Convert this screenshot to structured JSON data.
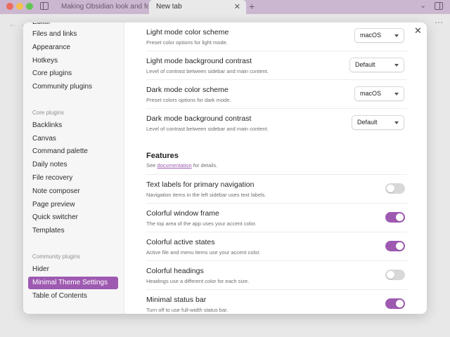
{
  "colors": {
    "accent": "#9e5ab1",
    "titlebar": "#cbb7cf"
  },
  "titlebar": {
    "tabs": [
      {
        "label": "Making Obsidian look and fe..."
      },
      {
        "label": "New tab"
      }
    ],
    "close_glyph": "✕",
    "new_tab_glyph": "+",
    "chevron_glyph": "⌄"
  },
  "background": {
    "nav_glyph": "←  →",
    "more_glyph": "⋯"
  },
  "modal": {
    "close_glyph": "✕",
    "sidebar": {
      "options_items": [
        {
          "label": "Editor"
        },
        {
          "label": "Files and links"
        },
        {
          "label": "Appearance"
        },
        {
          "label": "Hotkeys"
        },
        {
          "label": "Core plugins"
        },
        {
          "label": "Community plugins"
        }
      ],
      "core_heading": "Core plugins",
      "core_items": [
        {
          "label": "Backlinks"
        },
        {
          "label": "Canvas"
        },
        {
          "label": "Command palette"
        },
        {
          "label": "Daily notes"
        },
        {
          "label": "File recovery"
        },
        {
          "label": "Note composer"
        },
        {
          "label": "Page preview"
        },
        {
          "label": "Quick switcher"
        },
        {
          "label": "Templates"
        }
      ],
      "community_heading": "Community plugins",
      "community_items": [
        {
          "label": "Hider"
        },
        {
          "label": "Minimal Theme Settings",
          "active": true
        },
        {
          "label": "Table of Contents"
        }
      ]
    },
    "settings": [
      {
        "title": "Light mode color scheme",
        "desc": "Preset color options for light mode.",
        "value": "macOS"
      },
      {
        "title": "Light mode background contrast",
        "desc": "Level of contrast between sidebar and main content.",
        "value": "Default"
      },
      {
        "title": "Dark mode color scheme",
        "desc": "Preset colors options for dark mode.",
        "value": "macOS"
      },
      {
        "title": "Dark mode background contrast",
        "desc": "Level of contrast between sidebar and main content.",
        "value": "Default"
      }
    ],
    "features": {
      "title": "Features",
      "desc_before": "See ",
      "desc_link": "documentation",
      "desc_after": " for details."
    },
    "toggles": [
      {
        "title": "Text labels for primary navigation",
        "desc": "Navigation items in the left sidebar uses text labels.",
        "on": false
      },
      {
        "title": "Colorful window frame",
        "desc": "The top area of the app uses your accent color.",
        "on": true
      },
      {
        "title": "Colorful active states",
        "desc": "Active file and menu items use your accent color.",
        "on": true
      },
      {
        "title": "Colorful headings",
        "desc": "Headings use a different color for each size.",
        "on": false
      },
      {
        "title": "Minimal status bar",
        "desc": "Turn off to use full-width status bar.",
        "on": true
      }
    ]
  }
}
